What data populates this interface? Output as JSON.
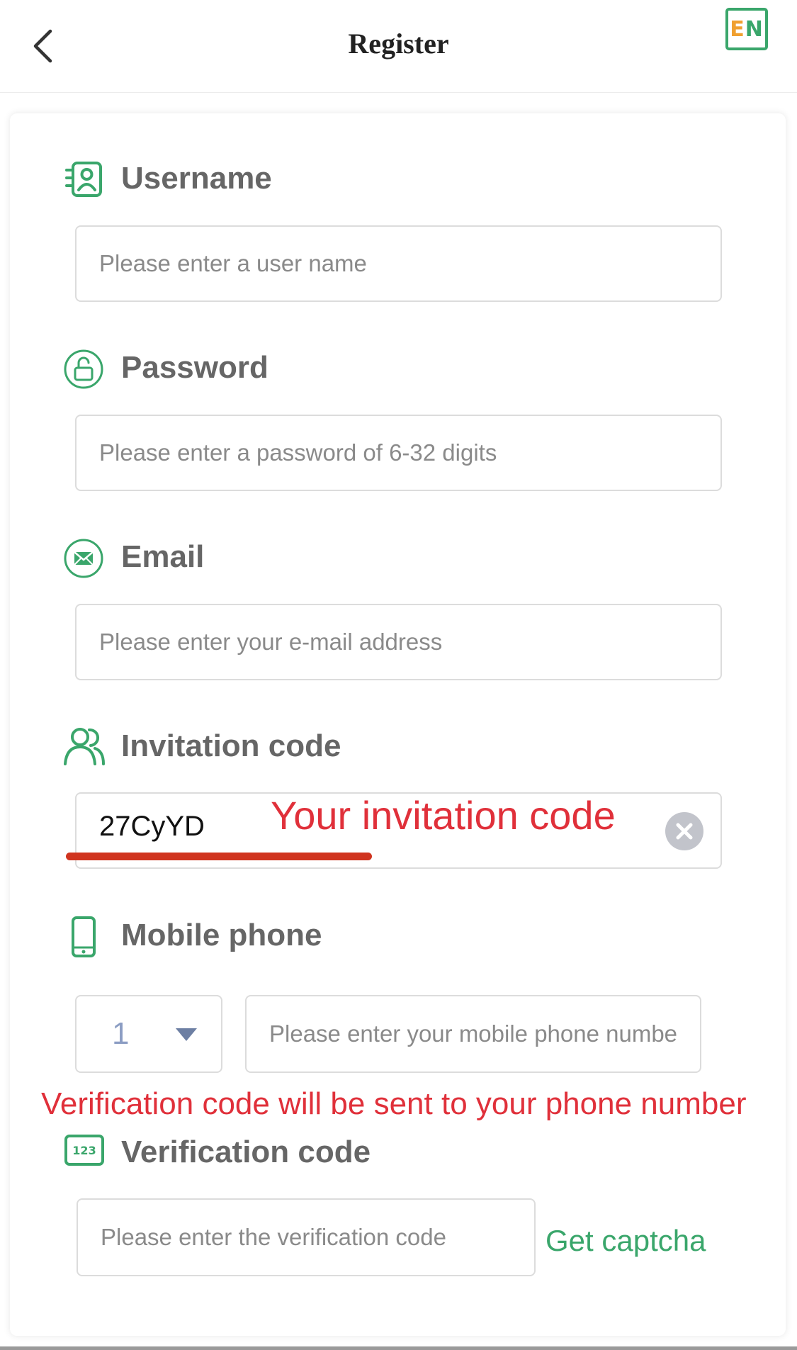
{
  "header": {
    "title": "Register",
    "language_label_first": "E",
    "language_label_second": "N"
  },
  "form": {
    "username": {
      "label": "Username",
      "placeholder": "Please enter a user name",
      "icon": "user-card-icon"
    },
    "password": {
      "label": "Password",
      "placeholder": "Please enter a password of 6-32 digits",
      "icon": "lock-icon"
    },
    "email": {
      "label": "Email",
      "placeholder": "Please enter your e-mail address",
      "icon": "mail-icon"
    },
    "invitation": {
      "label": "Invitation code",
      "value": "27CyYD",
      "icon": "users-icon"
    },
    "mobile": {
      "label": "Mobile phone",
      "country_code": "1",
      "placeholder": "Please enter your mobile phone number",
      "icon": "phone-icon"
    },
    "verification": {
      "label": "Verification code",
      "placeholder": "Please enter the verification code",
      "button_label": "Get captcha",
      "icon": "number-123-icon"
    }
  },
  "annotations": {
    "invitation_note": "Your invitation code",
    "phone_note": "Verification code will be sent to your phone number"
  },
  "colors": {
    "accent_green": "#3aa66b",
    "accent_orange": "#f0a030",
    "annotation_red": "#e0303a"
  }
}
